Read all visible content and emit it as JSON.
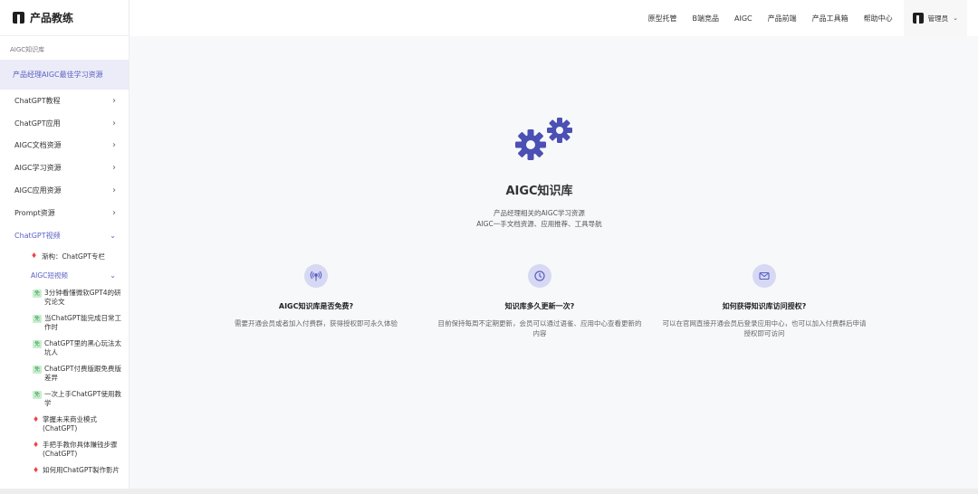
{
  "brand": {
    "name": "产品教练"
  },
  "sidebar": {
    "section_label": "AIGC知识库",
    "active_item": "产品经理AIGC最佳学习资源",
    "items": [
      {
        "label": "ChatGPT教程"
      },
      {
        "label": "ChatGPT应用"
      },
      {
        "label": "AIGC文档资源"
      },
      {
        "label": "AIGC学习资源"
      },
      {
        "label": "AIGC应用资源"
      },
      {
        "label": "Prompt资源"
      },
      {
        "label": "ChatGPT视频"
      }
    ],
    "sub_items": [
      {
        "label": "渐构：ChatGPT专栏"
      },
      {
        "label": "AIGC短视频"
      }
    ],
    "leaves": [
      {
        "badge": "免",
        "label": "3分钟看懂微软GPT4的研究论文"
      },
      {
        "badge": "免",
        "label": "当ChatGPT能完成日常工作时"
      },
      {
        "badge": "免",
        "label": "ChatGPT里的黑心玩法太坑人"
      },
      {
        "badge": "免",
        "label": "ChatGPT付费版跟免费版差异"
      },
      {
        "badge": "免",
        "label": "一次上手ChatGPT使用教学"
      },
      {
        "label": "掌握未来商业模式(ChatGPT)"
      },
      {
        "label": "手把手教你具体赚钱步骤(ChatGPT)"
      },
      {
        "label": "如何用ChatGPT製作影片"
      }
    ]
  },
  "topnav": {
    "links": [
      "原型托管",
      "B端竞品",
      "AIGC",
      "产品前端",
      "产品工具箱",
      "帮助中心"
    ],
    "user": "管理员"
  },
  "hero": {
    "title": "AIGC知识库",
    "line1": "产品经理相关的AIGC学习资源",
    "line2": "AIGC一手文档资源、应用推荐、工具导航"
  },
  "features": [
    {
      "icon": "broadcast-icon",
      "title": "AIGC知识库是否免费?",
      "desc": "需要开通会员或者加入付费群，获得授权即可永久体验"
    },
    {
      "icon": "clock-icon",
      "title": "知识库多久更新一次?",
      "desc": "目前保持每周不定期更新，会员可以通过语雀、应用中心查看更新的内容"
    },
    {
      "icon": "mail-icon",
      "title": "如何获得知识库访问授权?",
      "desc": "可以在官网直接开通会员后登录应用中心，也可以加入付费群后申请授权即可访问"
    }
  ],
  "colors": {
    "accent": "#5a5fc2",
    "icon_bg": "#d7d8f3",
    "gear": "#4b50b4"
  }
}
